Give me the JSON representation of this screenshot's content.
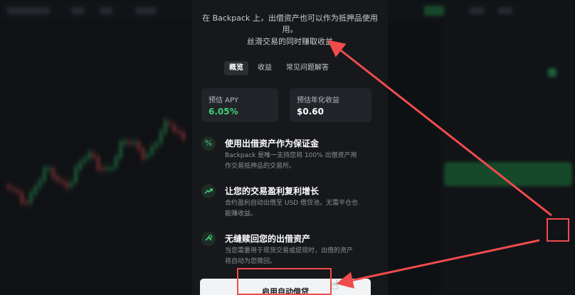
{
  "modal": {
    "intro": {
      "line1": "在 Backpack 上，出借资产也可以作为抵押品使用",
      "line2": "用。",
      "line3": "丝滑交易的同时赚取收益"
    },
    "tabs": [
      {
        "label": "概览",
        "active": true
      },
      {
        "label": "收益",
        "active": false
      },
      {
        "label": "常见问题解答",
        "active": false
      }
    ],
    "stats": {
      "apy_label": "预估 APY",
      "apy_value": "6.05%",
      "annual_label": "预估年化收益",
      "annual_value": "$0.60"
    },
    "features": [
      {
        "icon": "percent-icon",
        "title": "使用出借资产作为保证金",
        "desc_line1": "Backpack 是唯一支持您将 100% 出借资产用",
        "desc_line2": "作交易抵押品的交易所。"
      },
      {
        "icon": "trend-up-icon",
        "title": "让您的交易盈利复利增长",
        "desc_line1": "合约盈利自动出借至 USD 借贷池，无需平仓也",
        "desc_line2": "能赚收益。"
      },
      {
        "icon": "redeem-icon",
        "title": "无缝赎回您的出借资产",
        "desc_line1": "当您需要用于现货交易或提现时，出借的资产",
        "desc_line2": "将自动为您赎回。"
      }
    ],
    "cta_label": "启用自动借贷"
  },
  "colors": {
    "accent_green": "#3fd07a",
    "annotation_red": "#f04c4c",
    "modal_bg": "#16181b"
  }
}
